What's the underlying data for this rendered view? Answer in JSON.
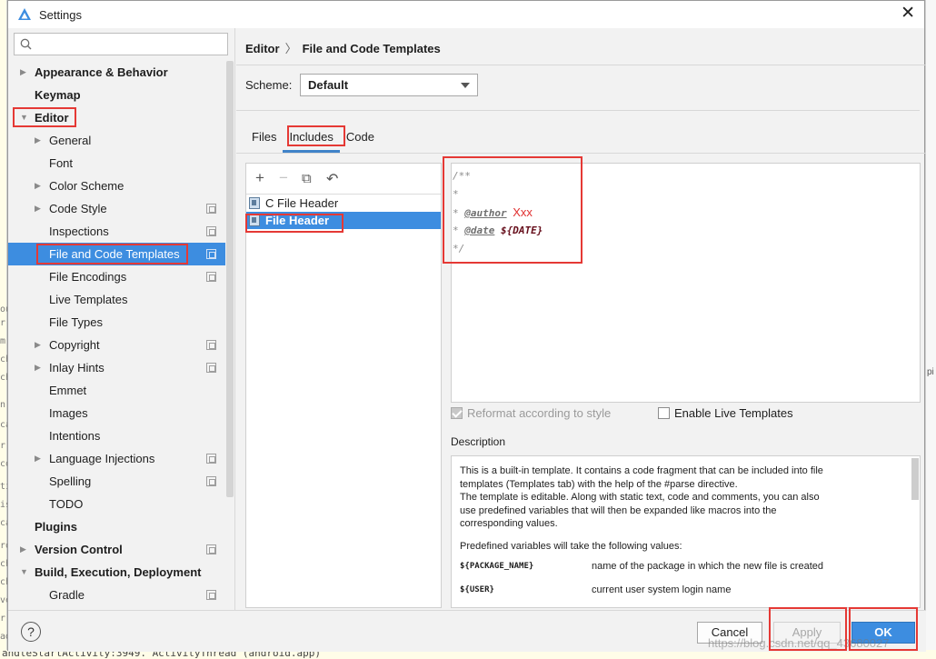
{
  "window": {
    "title": "Settings"
  },
  "background": {
    "left_fragments": [
      "ou",
      "m",
      "n",
      "ca",
      "r",
      "co",
      "ti",
      "is",
      "ca",
      "ro",
      "ch",
      "ch",
      "ve",
      "r",
      "ad",
      "ch",
      "ch",
      "r"
    ],
    "right_fragments": [
      "pi"
    ],
    "bottom_text": "andleStartActivity:3949. ActivityThread (android.app)"
  },
  "search": {
    "placeholder": "Q⌄",
    "value": ""
  },
  "tree": [
    {
      "label": "Appearance & Behavior",
      "level": 0,
      "arrow": "right",
      "bold": true
    },
    {
      "label": "Keymap",
      "level": 0,
      "arrow": "",
      "bold": true
    },
    {
      "label": "Editor",
      "level": 0,
      "arrow": "down",
      "bold": true
    },
    {
      "label": "General",
      "level": 1,
      "arrow": "right"
    },
    {
      "label": "Font",
      "level": 1,
      "arrow": ""
    },
    {
      "label": "Color Scheme",
      "level": 1,
      "arrow": "right"
    },
    {
      "label": "Code Style",
      "level": 1,
      "arrow": "right",
      "cfg": true
    },
    {
      "label": "Inspections",
      "level": 1,
      "arrow": "",
      "cfg": true
    },
    {
      "label": "File and Code Templates",
      "level": 1,
      "arrow": "",
      "cfg": true,
      "selected": true
    },
    {
      "label": "File Encodings",
      "level": 1,
      "arrow": "",
      "cfg": true
    },
    {
      "label": "Live Templates",
      "level": 1,
      "arrow": ""
    },
    {
      "label": "File Types",
      "level": 1,
      "arrow": ""
    },
    {
      "label": "Copyright",
      "level": 1,
      "arrow": "right",
      "cfg": true
    },
    {
      "label": "Inlay Hints",
      "level": 1,
      "arrow": "right",
      "cfg": true
    },
    {
      "label": "Emmet",
      "level": 1,
      "arrow": ""
    },
    {
      "label": "Images",
      "level": 1,
      "arrow": ""
    },
    {
      "label": "Intentions",
      "level": 1,
      "arrow": ""
    },
    {
      "label": "Language Injections",
      "level": 1,
      "arrow": "right",
      "cfg": true
    },
    {
      "label": "Spelling",
      "level": 1,
      "arrow": "",
      "cfg": true
    },
    {
      "label": "TODO",
      "level": 1,
      "arrow": ""
    },
    {
      "label": "Plugins",
      "level": 0,
      "arrow": "",
      "bold": true
    },
    {
      "label": "Version Control",
      "level": 0,
      "arrow": "right",
      "bold": true,
      "cfg": true
    },
    {
      "label": "Build, Execution, Deployment",
      "level": 0,
      "arrow": "down",
      "bold": true
    },
    {
      "label": "Gradle",
      "level": 1,
      "arrow": "",
      "cfg": true
    }
  ],
  "breadcrumb": {
    "parent": "Editor",
    "separator": "〉",
    "current": "File and Code Templates"
  },
  "scheme": {
    "label": "Scheme:",
    "value": "Default"
  },
  "tabs": [
    {
      "label": "Files",
      "active": false
    },
    {
      "label": "Includes",
      "active": true
    },
    {
      "label": "Code",
      "active": false
    }
  ],
  "toolbar": {
    "add": "+",
    "remove": "−",
    "copy": "⧉",
    "reset": "↶"
  },
  "templates": [
    {
      "label": "C File Header",
      "selected": false
    },
    {
      "label": "File Header",
      "selected": true
    }
  ],
  "editor": {
    "l1": "/**",
    "l2": " *",
    "l3_prefix": " * ",
    "l3_tag": "@author",
    "l3_value": "Xxx",
    "l4_prefix": " * ",
    "l4_tag": "@date",
    "l4_value": "${DATE}",
    "l5": " */"
  },
  "options": {
    "reformat": {
      "label": "Reformat according to style",
      "checked": true,
      "disabled": true
    },
    "live": {
      "label": "Enable Live Templates",
      "checked": false
    }
  },
  "description": {
    "label": "Description",
    "p1a": "This is a built-in template. It contains a code fragment that can be included into file",
    "p1b": "templates (Templates tab) with the help of the #parse directive.",
    "p1c": "The template is editable. Along with static text, code and comments, you can also",
    "p1d": "use predefined variables that will then be expanded like macros into the",
    "p1e": "corresponding values.",
    "p2": "Predefined variables will take the following values:",
    "vars": [
      {
        "name": "${PACKAGE_NAME}",
        "desc": "name of the package in which the new file is created"
      },
      {
        "name": "${USER}",
        "desc": "current user system login name"
      }
    ]
  },
  "buttons": {
    "help": "?",
    "cancel": "Cancel",
    "apply": "Apply",
    "ok": "OK"
  },
  "watermark": "https://blog.csdn.net/qq_43680027",
  "colors": {
    "selection": "#3d8de0",
    "highlight": "#e53935",
    "tab_underline": "#4083c9"
  }
}
